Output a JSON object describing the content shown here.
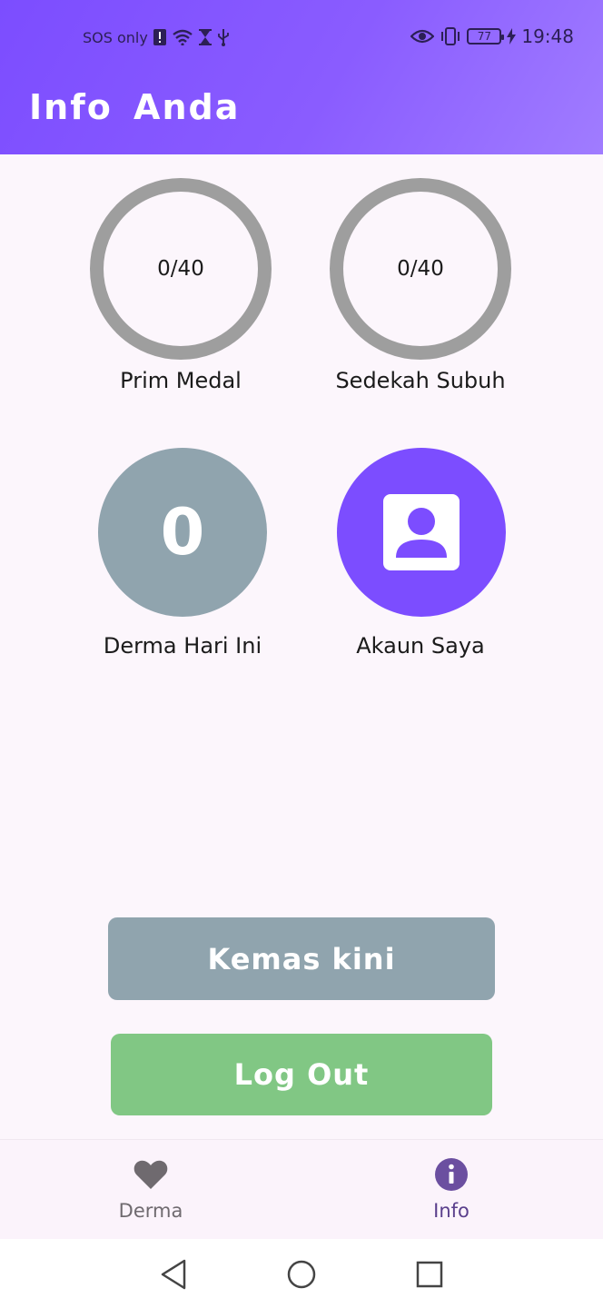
{
  "status_bar": {
    "carrier": "SOS only",
    "battery": "77",
    "time": "19:48",
    "icons": [
      "alert-icon",
      "wifi-icon",
      "hourglass-icon",
      "usb-icon",
      "eye-icon",
      "vibrate-icon",
      "battery-icon",
      "charging-icon"
    ]
  },
  "app_bar": {
    "title": "Info Anda"
  },
  "stats": {
    "prim_medal": {
      "value": "0/40",
      "label": "Prim Medal"
    },
    "sedekah_subuh": {
      "value": "0/40",
      "label": "Sedekah Subuh"
    },
    "derma_today": {
      "value": "0",
      "label": "Derma Hari Ini"
    },
    "account": {
      "label": "Akaun Saya",
      "icon": "account-box-icon"
    }
  },
  "actions": {
    "update_label": "Kemas kini",
    "logout_label": "Log Out"
  },
  "bottom_nav": {
    "items": [
      {
        "label": "Derma",
        "icon": "heart-icon"
      },
      {
        "label": "Info",
        "icon": "info-icon",
        "selected": true
      }
    ]
  },
  "system_nav": {
    "icons": [
      "back-icon",
      "home-icon",
      "recents-icon"
    ]
  },
  "colors": {
    "accent": "#7c4dff",
    "grey_blue": "#90a4ae",
    "green": "#81c784",
    "ring": "#9e9e9e",
    "nav_selected": "#5a3f8c"
  }
}
